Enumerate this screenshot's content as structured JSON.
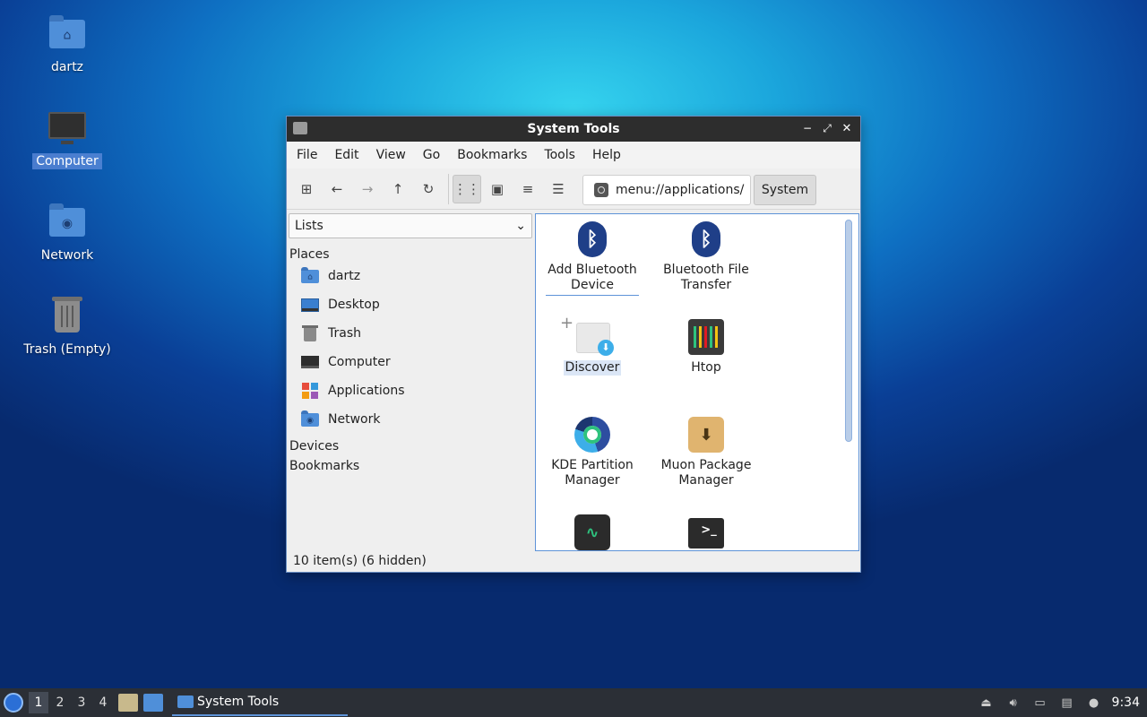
{
  "desktop": {
    "icons": [
      {
        "label": "dartz",
        "icon": "home-folder-icon"
      },
      {
        "label": "Computer",
        "icon": "computer-icon"
      },
      {
        "label": "Network",
        "icon": "network-folder-icon"
      },
      {
        "label": "Trash (Empty)",
        "icon": "trash-icon"
      }
    ]
  },
  "window": {
    "title": "System Tools",
    "controls": {
      "minimize": "−",
      "maximize": "⤢",
      "close": "✕"
    },
    "menu": [
      "File",
      "Edit",
      "View",
      "Go",
      "Bookmarks",
      "Tools",
      "Help"
    ],
    "toolbar": {
      "location": "menu://applications/",
      "crumb": "System"
    },
    "sidebar": {
      "selector": "Lists",
      "places_heading": "Places",
      "places": [
        "dartz",
        "Desktop",
        "Trash",
        "Computer",
        "Applications",
        "Network"
      ],
      "devices_heading": "Devices",
      "bookmarks_heading": "Bookmarks"
    },
    "apps": [
      {
        "line1": "Add Bluetooth",
        "line2": "Device"
      },
      {
        "line1": "Bluetooth File",
        "line2": "Transfer"
      },
      {
        "line1": "Discover",
        "line2": ""
      },
      {
        "line1": "Htop",
        "line2": ""
      },
      {
        "line1": "KDE Partition",
        "line2": "Manager"
      },
      {
        "line1": "Muon Package",
        "line2": "Manager"
      }
    ],
    "status": "10 item(s) (6 hidden)"
  },
  "taskbar": {
    "workspaces": [
      "1",
      "2",
      "3",
      "4"
    ],
    "task_label": "System Tools",
    "clock": "9:34"
  },
  "colors": {
    "accent": "#5e93d8",
    "titlebar": "#2d2d2d",
    "taskbar": "#2b2f36"
  }
}
